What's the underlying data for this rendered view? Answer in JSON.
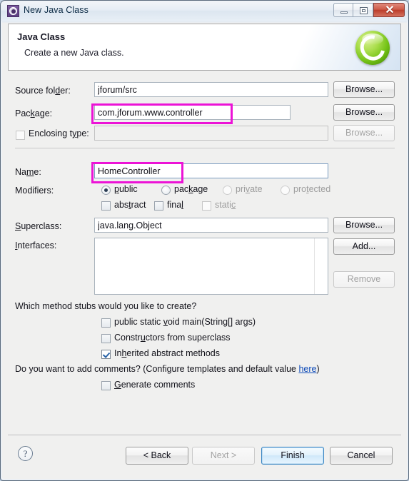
{
  "window": {
    "title": "New Java Class",
    "icon": "java-class-icon",
    "controls": {
      "minimize": "minimize-icon",
      "maximize": "restore-icon",
      "close": "✕"
    }
  },
  "banner": {
    "title": "Java Class",
    "subtitle": "Create a new Java class.",
    "icon": "green-c-wizard-icon"
  },
  "form": {
    "source_folder": {
      "label": "Source folder:",
      "value": "jforum/src",
      "browse": "Browse..."
    },
    "package": {
      "label": "Package:",
      "value": "com.jforum.www.controller",
      "browse": "Browse...",
      "highlighted": true
    },
    "enclosing_type": {
      "label": "Enclosing type:",
      "value": "",
      "checked": false,
      "enabled": false,
      "browse": "Browse..."
    },
    "name": {
      "label": "Name:",
      "value": "HomeController",
      "highlighted": true
    },
    "modifiers": {
      "label": "Modifiers:",
      "radios": [
        {
          "label": "public",
          "checked": true,
          "enabled": true
        },
        {
          "label": "package",
          "checked": false,
          "enabled": true
        },
        {
          "label": "private",
          "checked": false,
          "enabled": false
        },
        {
          "label": "protected",
          "checked": false,
          "enabled": false
        }
      ],
      "checkboxes": [
        {
          "label": "abstract",
          "checked": false,
          "enabled": true
        },
        {
          "label": "final",
          "checked": false,
          "enabled": true
        },
        {
          "label": "static",
          "checked": false,
          "enabled": false
        }
      ]
    },
    "superclass": {
      "label": "Superclass:",
      "value": "java.lang.Object",
      "browse": "Browse..."
    },
    "interfaces": {
      "label": "Interfaces:",
      "items": [],
      "add": "Add...",
      "remove": "Remove",
      "remove_enabled": false
    }
  },
  "stubs": {
    "question": "Which method stubs would you like to create?",
    "options": [
      {
        "label": "public static void main(String[] args)",
        "checked": false
      },
      {
        "label": "Constructors from superclass",
        "checked": false
      },
      {
        "label": "Inherited abstract methods",
        "checked": true
      }
    ]
  },
  "comments": {
    "question_before": "Do you want to add comments? (Configure templates and default value ",
    "link": "here",
    "question_after": ")",
    "option": {
      "label": "Generate comments",
      "checked": false
    }
  },
  "footer": {
    "help": "?",
    "back": "< Back",
    "next": "Next >",
    "next_enabled": false,
    "finish": "Finish",
    "cancel": "Cancel"
  },
  "annotation": {
    "color": "#ec13d6"
  }
}
